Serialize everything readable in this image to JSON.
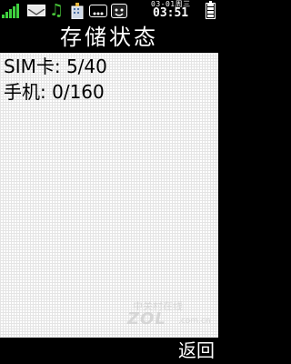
{
  "status_bar": {
    "signal_level": 5,
    "date": "03-01周三",
    "time": "03:51",
    "battery_level": 0.8,
    "icons": [
      "signal-icon",
      "message-icon",
      "music-icon",
      "building-icon",
      "chat-icon",
      "smile-icon",
      "battery-icon"
    ]
  },
  "title": "存储状态",
  "rows": [
    {
      "label": "SIM卡:",
      "value": "5/40"
    },
    {
      "label": "手机:",
      "value": "0/160"
    }
  ],
  "watermark": {
    "cn": "中关村在线",
    "logo": "ZOL",
    "sub": ".com.cn"
  },
  "softkeys": {
    "right": "返回"
  },
  "colors": {
    "bar_background": "#000000",
    "content_background": "#ffffff",
    "signal": "#3fd13f",
    "text_on_bar": "#ffffff"
  }
}
